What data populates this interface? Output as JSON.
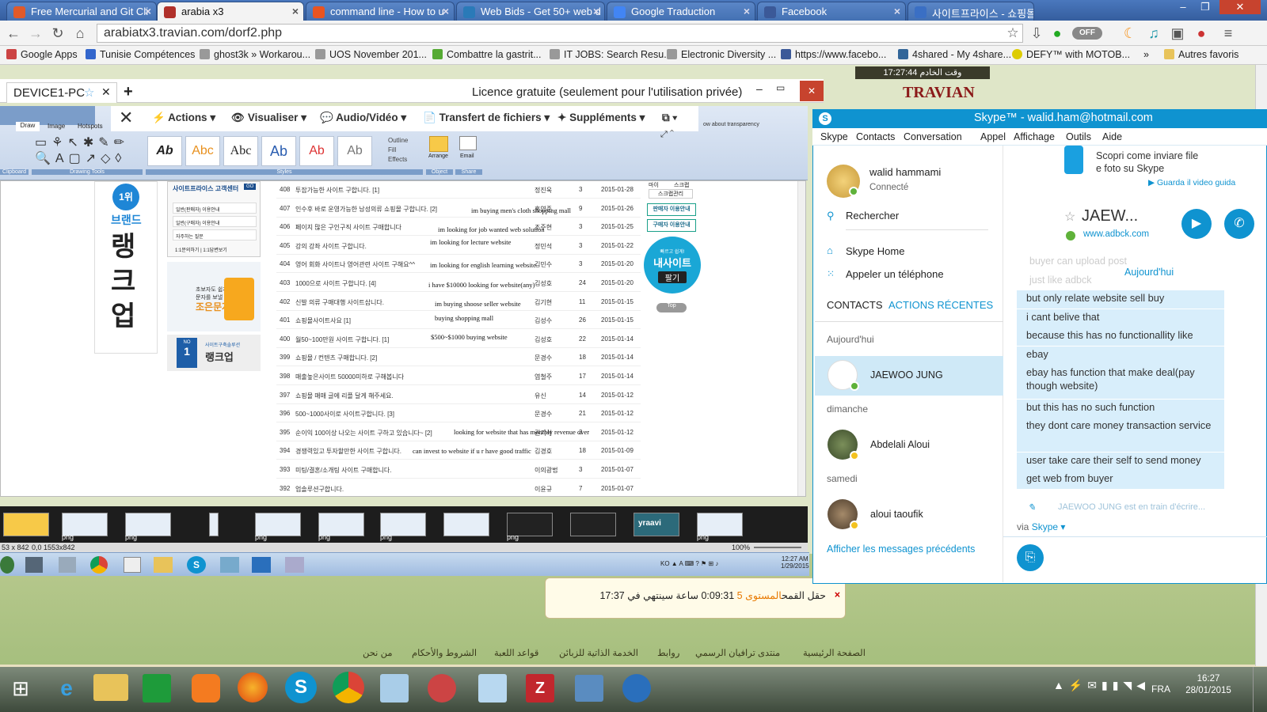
{
  "browser": {
    "tabs": [
      {
        "label": "Free Mercurial and Git Cli",
        "icon": "sourcetree-icon",
        "color": "#e05a2a",
        "active": false
      },
      {
        "label": "arabia x3",
        "icon": "travian-icon",
        "color": "#b0302a",
        "active": true
      },
      {
        "label": "command line - How to u",
        "icon": "askubuntu-icon",
        "color": "#e95420",
        "active": false
      },
      {
        "label": "Web Bids - Get 50+ web d",
        "icon": "globe-icon",
        "color": "#2a7ab8",
        "active": false
      },
      {
        "label": "Google Traduction",
        "icon": "translate-icon",
        "color": "#4285f4",
        "active": false
      },
      {
        "label": "Facebook",
        "icon": "facebook-icon",
        "color": "#3b5998",
        "active": false
      },
      {
        "label": "사이트프라이스 - 쇼핑몰",
        "icon": "document-icon",
        "color": "#3a6fc4",
        "active": false
      }
    ],
    "url": "arabiatx3.travian.com/dorf2.php",
    "off_toggle": "OFF",
    "bookmarks": [
      "Google Apps",
      "Tunisie Compétences",
      "ghost3k » Workarou...",
      "UOS November 201...",
      "Combattre la gastrit...",
      "IT JOBS: Search Resu...",
      "Electronic Diversity ...",
      "https://www.facebo...",
      "4shared - My 4share...",
      "DEFY™ with MOTOB...",
      "»",
      "Autres favoris"
    ]
  },
  "game": {
    "server_time_label": "وقت الخادم",
    "server_time": "17:27:44",
    "logo": "TRAVIAN",
    "build_notice": {
      "field": "حقل القمح",
      "level": "المستوى 5",
      "countdown": "0:09:31",
      "ends_text": "ساعة سينتهي في",
      "end_time": "17:37"
    },
    "footer_links": [
      "الصفحة الرئيسية",
      "منتدى ترافيان الرسمي",
      "روابط",
      "الخدمة الذاتية للزبائن",
      "قواعد اللعبة",
      "الشروط والأحكام",
      "من نحن"
    ]
  },
  "remote": {
    "device": "DEVICE1-PC",
    "license": "Licence gratuite (seulement pour l'utilisation privée)",
    "toolbar": [
      "Actions",
      "Visualiser",
      "Audio/Vidéo",
      "Transfert de fichiers",
      "Suppléments"
    ],
    "ribbon_tabs": [
      "Draw",
      "Image",
      "Hotspots"
    ],
    "ribbon_groups": [
      "Clipboard",
      "Drawing Tools",
      "Styles",
      "Object",
      "Share"
    ],
    "style_samples": [
      "Ab",
      "Abc",
      "Abc",
      "Ab",
      "Ab",
      "Ab"
    ],
    "style_menu": [
      "Outline",
      "Fill",
      "Effects"
    ],
    "arrange_label": "Arrange",
    "email_label": "Email",
    "transparency_hint": "ow about transparency",
    "left_panel": {
      "rank_badge": "1위",
      "brand": "브랜드",
      "vertical_text": [
        "랭",
        "크",
        "업"
      ],
      "service_center": "사이트프라이스 고객센터",
      "service_go": "GO",
      "service_items": [
        "일반(판매자) 이용안내",
        "일반(구매자) 이용안내",
        "자주하는 질문"
      ],
      "service_inquiry": [
        "1:1문의하기",
        "1:1답변보기"
      ],
      "sms_text": [
        "초보자도 쉽게",
        "문자를 보낼 수 있는"
      ],
      "sms_brand": "조은문자",
      "rankup_label": "사이트구축솔루션",
      "rankup_brand": "랭크업",
      "rankup_no": "NO",
      "rankup_num": "1"
    },
    "right_panel": {
      "tabs": [
        "마이",
        "스크랩"
      ],
      "scrap_manage": "스크랩관리",
      "seller_guide": "판매자 이용안내",
      "buyer_guide": "구매자 이용안내",
      "sell_small": "빠르고 쉽게!",
      "sell_big": "내사이트",
      "sell_btn": "팔기",
      "top": "Top"
    },
    "listing": [
      {
        "no": "408",
        "title": "투잡가능한 사이트 구합니다. [1]",
        "author": "정진욱",
        "views": "3",
        "date": "2015-01-28"
      },
      {
        "no": "407",
        "title": "인수후 바로 운영가능한 남성의류 쇼핑몰 구합니다. [2]",
        "author": "홍영준",
        "views": "9",
        "date": "2015-01-26"
      },
      {
        "no": "406",
        "title": "페이지 많은 구인구직 사이트 구매합니다",
        "author": "조주현",
        "views": "3",
        "date": "2015-01-25"
      },
      {
        "no": "405",
        "title": "강의 강좌 사이트 구합니다.",
        "author": "정민석",
        "views": "3",
        "date": "2015-01-22"
      },
      {
        "no": "404",
        "title": "영어 회화 사이트나 영어관련 사이트 구해요^^",
        "author": "김민수",
        "views": "3",
        "date": "2015-01-20"
      },
      {
        "no": "403",
        "title": "1000으로 사이트 구합니다. [4]",
        "author": "김성호",
        "views": "24",
        "date": "2015-01-20"
      },
      {
        "no": "402",
        "title": "신발 의류 구매대행 사이트삽니다.",
        "author": "김기현",
        "views": "11",
        "date": "2015-01-15"
      },
      {
        "no": "401",
        "title": "쇼핑몰사이트사요 [1]",
        "author": "김성수",
        "views": "26",
        "date": "2015-01-15"
      },
      {
        "no": "400",
        "title": "월50~100만원 사이트 구합니다. [1]",
        "author": "김성호",
        "views": "22",
        "date": "2015-01-14"
      },
      {
        "no": "399",
        "title": "쇼핑몰 / 컨텐츠 구매합니다. [2]",
        "author": "문경수",
        "views": "18",
        "date": "2015-01-14"
      },
      {
        "no": "398",
        "title": "매출높은사이트 50000미하로 구해봅니다",
        "author": "염철주",
        "views": "17",
        "date": "2015-01-14"
      },
      {
        "no": "397",
        "title": "쇼핑몰 매매 글에 리플 달게 해주세요.",
        "author": "유신",
        "views": "14",
        "date": "2015-01-12"
      },
      {
        "no": "396",
        "title": "500~1000사이로 사이트구합니다. [3]",
        "author": "문경수",
        "views": "21",
        "date": "2015-01-12"
      },
      {
        "no": "395",
        "title": "순이익 100이상 나오는 사이트 구하고 있습니다~ [2]",
        "author": "권기석",
        "views": "3",
        "date": "2015-01-12"
      },
      {
        "no": "394",
        "title": "경쟁력있고 투자할만한 사이트 구합니다.",
        "author": "김경호",
        "views": "18",
        "date": "2015-01-09"
      },
      {
        "no": "393",
        "title": "미팅/결혼/소개팅 사이트 구매합니다.",
        "author": "이의광법",
        "views": "3",
        "date": "2015-01-07"
      },
      {
        "no": "392",
        "title": "업솔루션구합니다.",
        "author": "이윤규",
        "views": "7",
        "date": "2015-01-07"
      }
    ],
    "annotations": [
      "im buying men's cloth shopping mall",
      "im looking for job wanted web solution",
      "im looking for lecture website",
      "im looking for english learning website",
      "i have $10000 looking for website(any)",
      "im buying shoose seller website",
      "buying shopping mall",
      "$500~$1000 buying website",
      "looking for website that has monthly revenue over",
      "can invest to website if u r have good traffic"
    ],
    "thumb_labels": [
      "png",
      "png",
      "png",
      "png",
      "png",
      "png",
      "png"
    ],
    "brand_thumb": "yraavi",
    "status_left": "53 x 842",
    "status_coords": "0,0  1553x842",
    "zoom": "100%",
    "clock_time": "12:27 AM",
    "clock_date": "1/29/2015",
    "tray_lang": "KO"
  },
  "skype": {
    "title": "Skype™ - walid.ham@hotmail.com",
    "menu": [
      "Skype",
      "Contacts",
      "Conversation",
      "Appel",
      "Affichage",
      "Outils",
      "Aide"
    ],
    "user_name": "walid hammami",
    "user_status": "Connecté",
    "search": "Rechercher",
    "home": "Skype Home",
    "call_phone": "Appeler un téléphone",
    "tab_contacts": "CONTACTS",
    "tab_recent": "ACTIONS RÉCENTES",
    "groups": [
      "Aujourd'hui",
      "dimanche",
      "samedi"
    ],
    "contacts": [
      "JAEWOO JUNG",
      "Abdelali Aloui",
      "aloui taoufik"
    ],
    "show_previous": "Afficher les messages précédents",
    "promo_line1": "Scopri come inviare file",
    "promo_line2": "e foto su Skype",
    "promo_link": "Guarda il video guida",
    "chat_name": "JAEW...",
    "chat_site": "www.adbck.com",
    "faded_lines": [
      "buyer can upload post",
      "just like adbck"
    ],
    "today": "Aujourd'hui",
    "messages": [
      "but only relate website sell buy",
      "i cant belive that",
      "because this has no functionallity like",
      "ebay",
      "ebay has function that make deal(pay though website)",
      "but this has no such function",
      "they dont care money transaction service",
      "user take care their self to send money",
      "get web from buyer"
    ],
    "typing": "JAEWOO JUNG est en train d'écrire...",
    "via_label": "via",
    "via_service": "Skype"
  },
  "taskbar": {
    "time": "16:27",
    "date": "28/01/2015",
    "lang": "FRA"
  },
  "colors": {
    "skype_blue": "#0f93d0",
    "chrome_blue": "#3f6cb0",
    "online_green": "#5fb23a",
    "away_yellow": "#f3c21f"
  }
}
